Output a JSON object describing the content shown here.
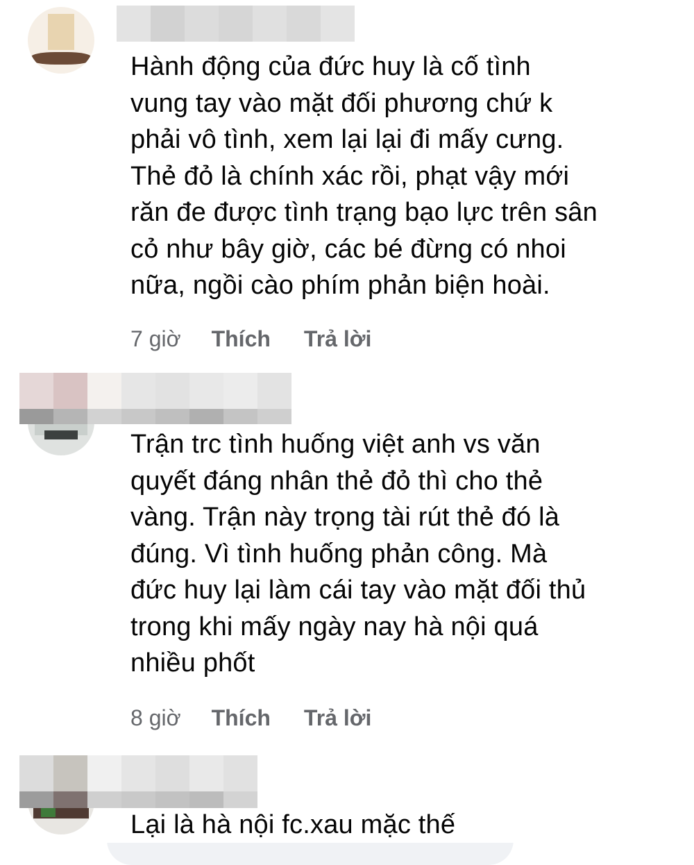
{
  "comments": [
    {
      "text": "Hành động của đức huy là cố tình\nvung tay vào mặt đối phương chứ k\nphải vô tình, xem lại lại đi mấy cưng.\nThẻ đỏ là chính xác rồi, phạt vậy mới\nrăn đe được tình trạng bạo lực trên sân\ncỏ như bây giờ, các bé đừng có nhoi\nnữa, ngồi cào phím phản biện hoài.",
      "time": "7 giờ",
      "like": "Thích",
      "reply": "Trả lời"
    },
    {
      "text": "Trận trc tình huống việt anh vs văn\nquyết đáng nhân thẻ đỏ thì cho thẻ\nvàng. Trận này trọng tài rút thẻ đó là\nđúng. Vì tình huống phản công. Mà\nđức huy lại làm cái tay vào mặt đối thủ\ntrong khi mấy ngày nay hà nội quá\nnhiều phốt",
      "time": "8 giờ",
      "like": "Thích",
      "reply": "Trả lời"
    },
    {
      "text": "Lại là hà nội fc.xau mặc thế"
    }
  ],
  "colors": {
    "bubble": "#f0f2f5",
    "text": "#050505",
    "meta": "#65676b"
  }
}
